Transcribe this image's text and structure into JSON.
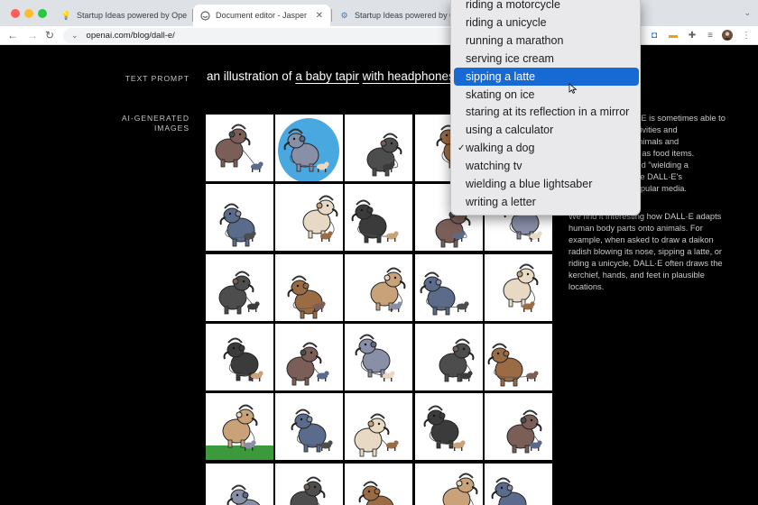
{
  "browser": {
    "tabs": [
      {
        "title": "Startup Ideas powered by Ope",
        "icon": "lightbulb-icon",
        "active": false
      },
      {
        "title": "Document editor - Jasper",
        "icon": "jasper-icon",
        "active": true
      },
      {
        "title": "Startup Ideas powered by Ope",
        "icon": "gear-icon",
        "active": false
      }
    ],
    "url": "openai.com/blog/dall-e/"
  },
  "article": {
    "text_prompt_label": "TEXT PROMPT",
    "prompt": {
      "prefix": "an illustration of",
      "subject": "a baby tapir",
      "modifier": "with headphones"
    },
    "images_label_line1": "AI-GENERATED",
    "images_label_line2": "IMAGES",
    "side_paragraph_1": [
      "DALL·E is sometimes able to",
      "an activities and",
      "g to animals and",
      ", such as food items.",
      "hu\" and \"wielding a",
      "explore DALL·E's",
      "ate popular media."
    ],
    "side_paragraph_2": [
      "We find it interesting how DALL·E adapts",
      "human body parts onto animals. For",
      "example, when asked to draw a daikon",
      "radish blowing its nose, sipping a latte, or",
      "riding a unicycle, DALL·E often draws the",
      "kerchief, hands, and feet in plausible",
      "locations."
    ]
  },
  "dropdown": {
    "items": [
      {
        "label": "riding a motorcycle",
        "selected": false,
        "checked": false
      },
      {
        "label": "riding a unicycle",
        "selected": false,
        "checked": false
      },
      {
        "label": "running a marathon",
        "selected": false,
        "checked": false
      },
      {
        "label": "serving ice cream",
        "selected": false,
        "checked": false
      },
      {
        "label": "sipping a latte",
        "selected": true,
        "checked": false
      },
      {
        "label": "skating on ice",
        "selected": false,
        "checked": false
      },
      {
        "label": "staring at its reflection in a mirror",
        "selected": false,
        "checked": false
      },
      {
        "label": "using a calculator",
        "selected": false,
        "checked": false
      },
      {
        "label": "walking a dog",
        "selected": false,
        "checked": true
      },
      {
        "label": "watching tv",
        "selected": false,
        "checked": false
      },
      {
        "label": "wielding a blue lightsaber",
        "selected": false,
        "checked": false
      },
      {
        "label": "writing a letter",
        "selected": false,
        "checked": false
      }
    ],
    "checkmark": "✓"
  },
  "image_grid": {
    "rows": 6,
    "cols": 5,
    "alt": "tapir with headphones illustration",
    "palette": [
      "#7b5e57",
      "#8a8fa8",
      "#4d4d4d",
      "#9b6b43",
      "#c9a27a",
      "#5a6b8c",
      "#e7d9c4",
      "#3b3b3b"
    ]
  }
}
